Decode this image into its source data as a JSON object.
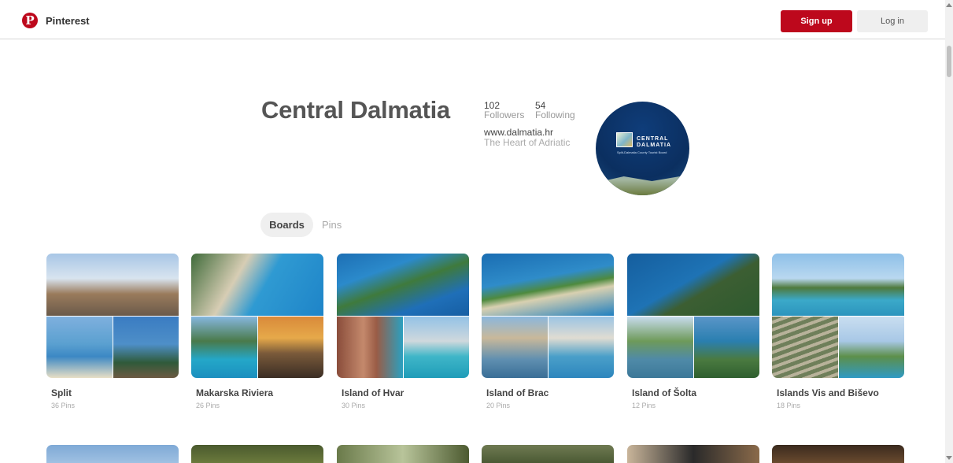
{
  "header": {
    "logo_letter": "P",
    "brand": "Pinterest",
    "signup_label": "Sign up",
    "login_label": "Log in",
    "brand_color": "#bd081c"
  },
  "profile": {
    "name": "Central Dalmatia",
    "followers_count": "102",
    "followers_label": "Followers",
    "following_count": "54",
    "following_label": "Following",
    "website": "www.dalmatia.hr",
    "tagline": "The Heart of Adriatic",
    "avatar_text_1": "CENTRAL",
    "avatar_text_2": "DALMATIA",
    "avatar_subtext": "Split-Dalmatia County Tourist Board"
  },
  "tabs": [
    {
      "label": "Boards",
      "active": true
    },
    {
      "label": "Pins",
      "active": false
    }
  ],
  "boards": [
    {
      "title": "Split",
      "count": "36 Pins"
    },
    {
      "title": "Makarska Riviera",
      "count": "26 Pins"
    },
    {
      "title": "Island of Hvar",
      "count": "30 Pins"
    },
    {
      "title": "Island of Brac",
      "count": "20 Pins"
    },
    {
      "title": "Island of Šolta",
      "count": "12 Pins"
    },
    {
      "title": "Islands Vis and Biševo",
      "count": "18 Pins"
    }
  ],
  "icons": {
    "logo": "pinterest-logo-icon",
    "scroll_up": "scroll-up-arrow-icon",
    "scroll_down": "scroll-down-arrow-icon"
  }
}
